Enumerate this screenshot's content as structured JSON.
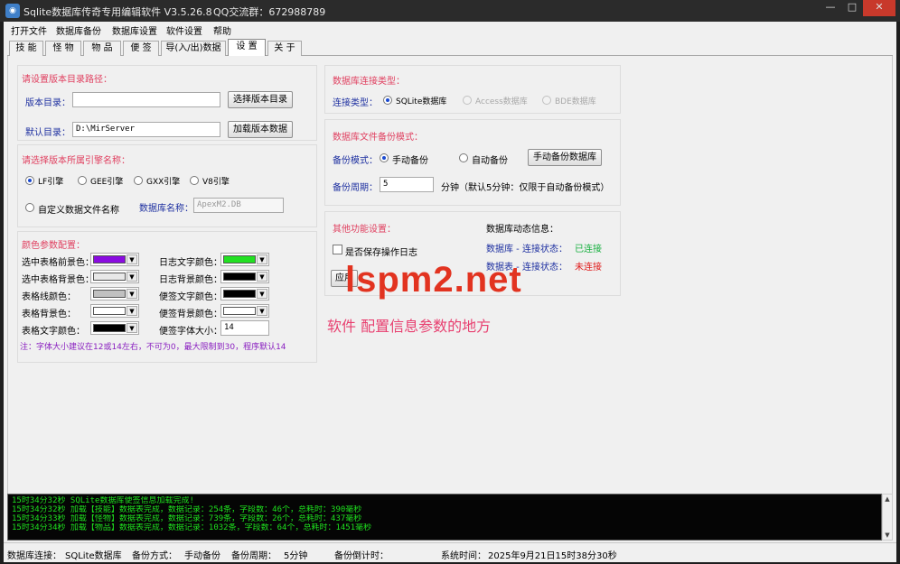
{
  "window": {
    "title": "Sqlite数据库传奇专用编辑软件 V3.5.26.8",
    "qq_group": "QQ交流群：672988789",
    "min_glyph": "—",
    "max_glyph": "□",
    "close_glyph": "✕"
  },
  "menu": [
    "打开文件",
    "数据库备份",
    "数据库设置",
    "软件设置",
    "帮助"
  ],
  "tabs": [
    "技 能",
    "怪 物",
    "物 品",
    "便 签",
    "导(入/出)数据",
    "设 置",
    "关 于"
  ],
  "active_tab": "设 置",
  "version_panel": {
    "title": "请设置版本目录路径：",
    "version_dir_label": "版本目录：",
    "version_dir_value": "",
    "select_button": "选择版本目录",
    "default_dir_label": "默认目录：",
    "default_dir_value": "D:\\MirServer",
    "load_button": "加载版本数据"
  },
  "engine_panel": {
    "title": "请选择版本所属引擎名称：",
    "engines": [
      "LF引擎",
      "GEE引擎",
      "GXX引擎",
      "V8引擎"
    ],
    "selected_engine": "LF引擎",
    "custom_label": "自定义数据文件名称",
    "db_name_label": "数据库名称：",
    "db_name_value": "ApexM2.DB"
  },
  "color_panel": {
    "title": "颜色参数配置：",
    "left": [
      {
        "label": "选中表格前景色：",
        "color": "#8a0ce0"
      },
      {
        "label": "选中表格背景色：",
        "color": "#e8e8e8"
      },
      {
        "label": "表格线颜色：",
        "color": "#c0c0c0"
      },
      {
        "label": "表格背景色：",
        "color": "#ffffff"
      },
      {
        "label": "表格文字颜色：",
        "color": "#000000"
      }
    ],
    "right": [
      {
        "label": "日志文字颜色：",
        "color": "#22e022"
      },
      {
        "label": "日志背景颜色：",
        "color": "#000000"
      },
      {
        "label": "便签文字颜色：",
        "color": "#000000"
      },
      {
        "label": "便签背景颜色：",
        "color": "#ffffff"
      }
    ],
    "font_size_label": "便签字体大小：",
    "font_size_value": "14",
    "note": "注：字体大小建议在12或14左右，不可为0，最大限制到30，程序默认14"
  },
  "conn_panel": {
    "title": "数据库连接类型：",
    "type_label": "连接类型：",
    "options": [
      "SQLite数据库",
      "Access数据库",
      "BDE数据库"
    ],
    "selected": "SQLite数据库"
  },
  "backup_panel": {
    "title": "数据库文件备份模式：",
    "mode_label": "备份模式：",
    "manual_label": "手动备份",
    "auto_label": "自动备份",
    "backup_button": "手动备份数据库",
    "period_label": "备份周期：",
    "period_value": "5",
    "period_hint": "分钟（默认5分钟：仅限于自动备份模式）"
  },
  "other_panel": {
    "title": "其他功能设置：",
    "save_log_label": "是否保存操作日志",
    "apply_button": "应用",
    "status_title": "数据库动态信息：",
    "db_status_label": "数据库 - 连接状态：",
    "db_status_value": "已连接",
    "table_status_label": "数据表 - 连接状态：",
    "table_status_value": "未连接"
  },
  "watermark": "lspm2.net",
  "big_note": "软件 配置信息参数的地方",
  "log_lines": [
    "15时34分32秒   SQLite数据库便签信息加载完成!",
    "15时34分32秒   加载【技能】数据表完成，数据记录：254条，字段数：46个，总耗时：390毫秒",
    "15时34分33秒   加载【怪物】数据表完成，数据记录：739条，字段数：26个，总耗时：437毫秒",
    "15时34分34秒   加载【物品】数据表完成，数据记录：1032条，字段数：64个，总耗时：1451毫秒"
  ],
  "statusbar": {
    "conn_label": "数据库连接：",
    "conn_value": "SQLite数据库",
    "mode_label": "备份方式：",
    "mode_value": "手动备份",
    "period_label": "备份周期：",
    "period_value": "5分钟",
    "countdown_label": "备份倒计时：",
    "time_label": "系统时间：",
    "time_value": "2025年9月21日15时38分30秒"
  },
  "colors": {
    "section_title": "#e04060",
    "label_blue": "#1d2fa0",
    "connected": "#18b040",
    "disconnected": "#e01818",
    "log_text": "#1ee01e"
  }
}
